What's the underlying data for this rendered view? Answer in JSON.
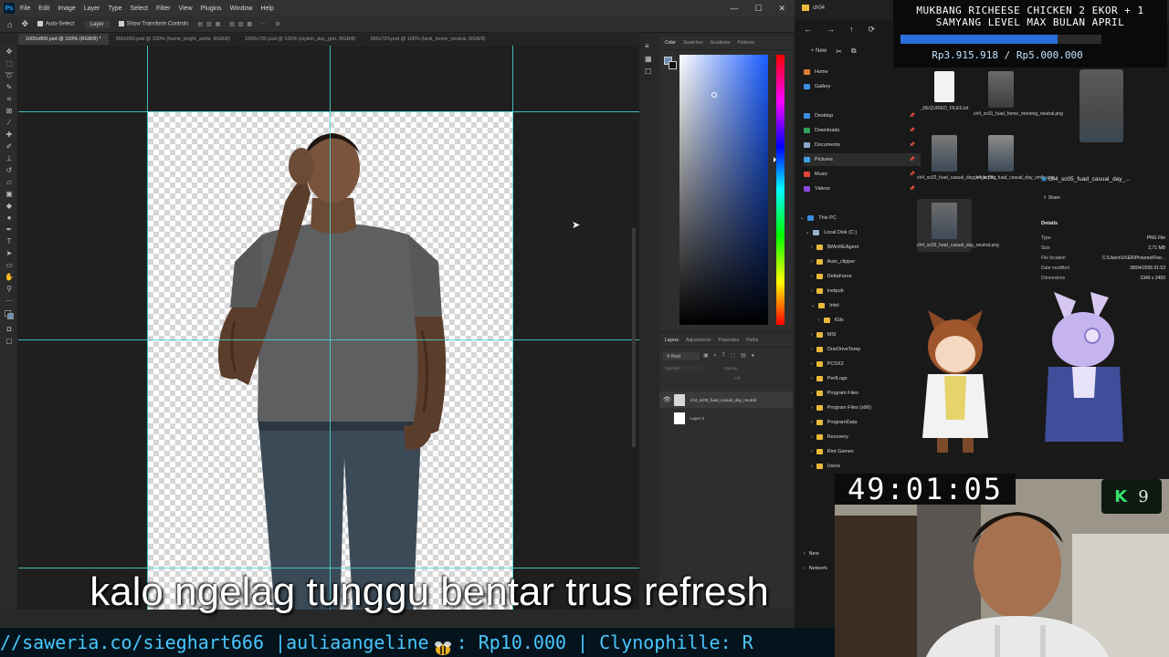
{
  "photoshop": {
    "logo": "Ps",
    "menu": [
      "File",
      "Edit",
      "Image",
      "Layer",
      "Type",
      "Select",
      "Filter",
      "View",
      "Plugins",
      "Window",
      "Help"
    ],
    "window_controls": [
      "—",
      "☐",
      "✕"
    ],
    "options_bar": {
      "auto_select_label": "Auto-Select:",
      "auto_select_target": "Layer",
      "show_transform_label": "Show Transform Controls"
    },
    "tabs": [
      "1000x800.psd @ 100% (RGB/8) *",
      "950x650.psd @ 100% (home_bright_smile, RGB/8)",
      "1000x720.psd @ 100% (stylish_day_grin, RGB/8)",
      "990x720.psd @ 100% (tank_home_neutral, RGB/8)"
    ],
    "color_panel": {
      "tabs": [
        "Color",
        "Swatches",
        "Gradients",
        "Patterns"
      ],
      "active_tab": "Color"
    },
    "layers_panel": {
      "tabs": [
        "Layers",
        "Adjustments",
        "Properties",
        "Paths"
      ],
      "active_tab": "Layers",
      "filter_label": "Kind",
      "blend_mode": "Normal",
      "opacity_label": "Opacity:",
      "fill_label": "Fill:",
      "layers": [
        {
          "name": "ch4_sc05_fuad_casual_day_neutral",
          "visible": true
        },
        {
          "name": "Layer 0",
          "visible": false
        }
      ]
    }
  },
  "explorer": {
    "title": "ch04",
    "nav": [
      "←",
      "→",
      "↑",
      "⟳"
    ],
    "new_label": "New",
    "sidebar": {
      "quick": [
        {
          "label": "Home",
          "icon": "home-icon"
        },
        {
          "label": "Gallery",
          "icon": "gallery-icon"
        }
      ],
      "pinned": [
        {
          "label": "Desktop"
        },
        {
          "label": "Downloads"
        },
        {
          "label": "Documents"
        },
        {
          "label": "Pictures",
          "selected": true
        },
        {
          "label": "Music"
        },
        {
          "label": "Videos"
        }
      ],
      "this_pc": "This PC",
      "drive": "Local Disk (C:)",
      "folders": [
        "$WinREAgent",
        "Auto_clipper",
        "DeltaForce",
        "inetpub",
        "Intel",
        "IGfx",
        "MSI",
        "OneDriveTemp",
        "PCSX2",
        "PerfLogs",
        "Program Files",
        "Program Files (x86)",
        "ProgramData",
        "Recovery",
        "Riot Games",
        "Users"
      ],
      "bottom": [
        "New",
        "Network"
      ]
    },
    "files": [
      {
        "name": "_REQUIRED_FILES.txt",
        "kind": "doc"
      },
      {
        "name": "ch4_sc01_fuad_home_morning_neutral.png",
        "kind": "img"
      },
      {
        "name": "ch4_sc02_fuad_casual_day_smile.png",
        "kind": "img"
      },
      {
        "name": "ch4_sc03c_fuad_casual_day_smile.png",
        "kind": "img"
      },
      {
        "name": "ch4_sc05_fuad_casual_day_neutral.png",
        "kind": "img",
        "selected": true
      }
    ],
    "details": {
      "file_title": "ch4_sc05_fuad_casual_day_...",
      "share_label": "Share",
      "section": "Details",
      "rows": [
        {
          "k": "Type",
          "v": "PNG File"
        },
        {
          "k": "Size",
          "v": "2,71 MB"
        },
        {
          "k": "File location",
          "v": "C:\\Users\\USER\\Pictures\\Five..."
        },
        {
          "k": "Date modified",
          "v": "28/04/2026 01:53"
        },
        {
          "k": "Dimensions",
          "v": "1340 x 2400"
        }
      ]
    }
  },
  "overlay": {
    "donation_goal": {
      "title_line1": "MUKBANG RICHEESE CHICKEN 2 EKOR + 1",
      "title_line2": "SAMYANG LEVEL MAX BULAN APRIL",
      "amount_text": "Rp3.915.918 / Rp5.000.000",
      "progress_fraction": 0.783
    },
    "timer": "49:01:05",
    "k_badge": {
      "letter": "K",
      "count": "9"
    },
    "subtitle": "kalo ngelag tunggu bentar trus refresh",
    "ticker_left": "//saweria.co/sieghart666 |auliaangeline",
    "ticker_right": ": Rp10.000 | Clynophille: R"
  },
  "colors": {
    "guide": "#4ad6d6",
    "ticker_text": "#49c6ff",
    "progress_fill": "#2a6fdb",
    "folder": "#e8b93b"
  }
}
